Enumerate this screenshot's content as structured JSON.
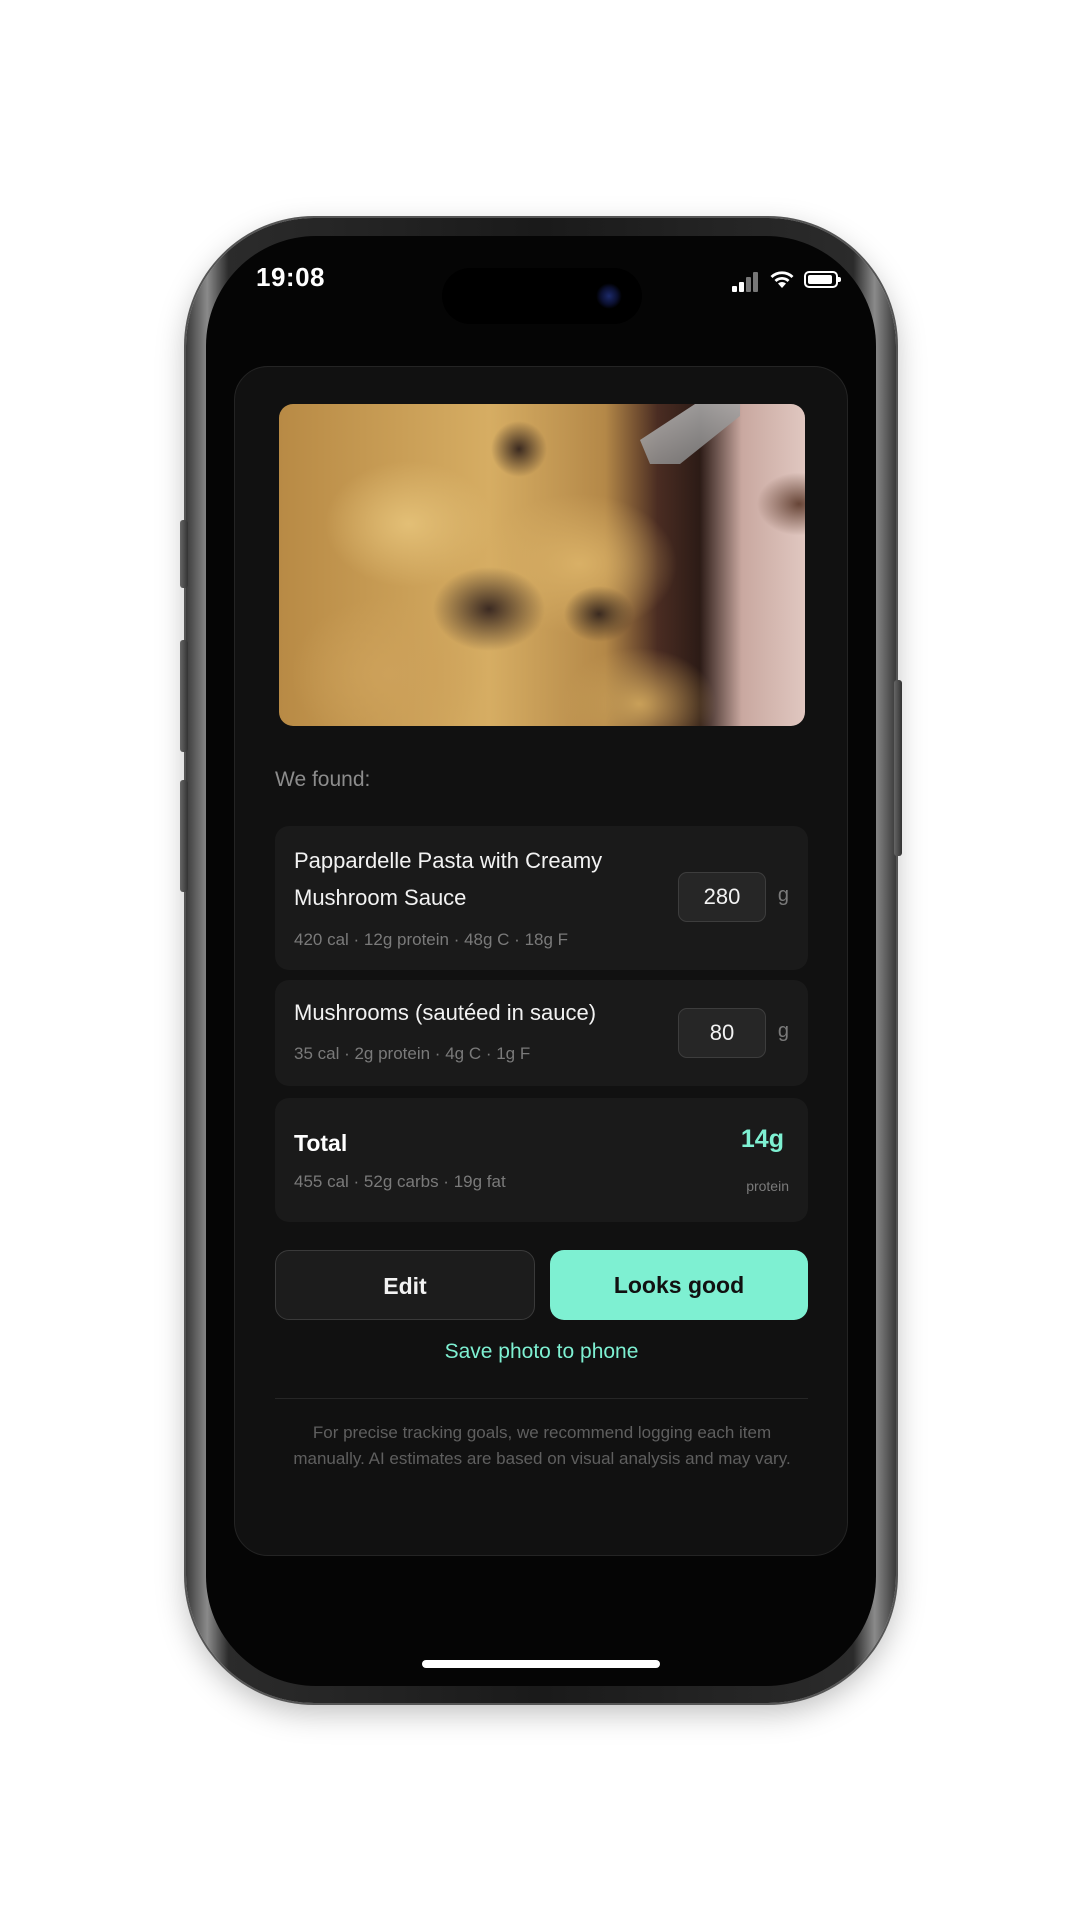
{
  "status_bar": {
    "time": "19:08"
  },
  "result": {
    "heading": "We found:",
    "items": [
      {
        "name": "Pappardelle Pasta with Creamy Mushroom Sauce",
        "macros": "420 cal · 12g protein · 48g C · 18g F",
        "quantity": "280",
        "unit": "g"
      },
      {
        "name": "Mushrooms (sautéed in sauce)",
        "macros": "35 cal · 2g protein · 4g C · 1g F",
        "quantity": "80",
        "unit": "g"
      }
    ],
    "total": {
      "label": "Total",
      "macros": "455 cal · 52g carbs · 19g fat",
      "protein_value": "14g",
      "protein_label": "protein"
    }
  },
  "actions": {
    "edit_label": "Edit",
    "confirm_label": "Looks good",
    "save_photo_label": "Save photo to phone"
  },
  "disclaimer": "For precise tracking goals, we recommend logging each item manually. AI estimates are based on visual analysis and may vary.",
  "colors": {
    "accent": "#7ef0d2",
    "card": "#111111",
    "row": "#1a1a1a"
  },
  "photo": {
    "subject": "pappardelle-mushroom-pasta-photo"
  }
}
